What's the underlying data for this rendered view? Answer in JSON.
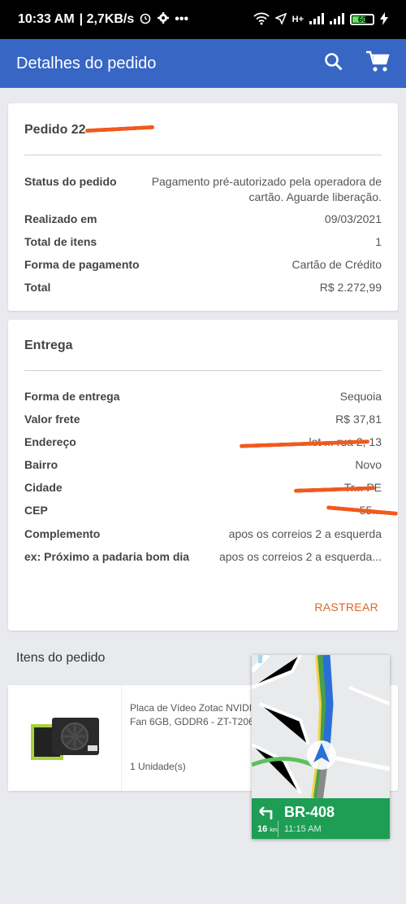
{
  "statusbar": {
    "time": "10:33 AM",
    "speed": "| 2,7KB/s",
    "battery": "60",
    "network": "H+"
  },
  "appbar": {
    "title": "Detalhes do pedido"
  },
  "pedido": {
    "title": "Pedido 22",
    "rows": [
      {
        "label": "Status do pedido",
        "value": "Pagamento pré-autorizado pela operadora de cartão. Aguarde liberação."
      },
      {
        "label": "Realizado em",
        "value": "09/03/2021"
      },
      {
        "label": "Total de itens",
        "value": "1"
      },
      {
        "label": "Forma de pagamento",
        "value": "Cartão de Crédito"
      },
      {
        "label": "Total",
        "value": "R$ 2.272,99"
      }
    ]
  },
  "entrega": {
    "title": "Entrega",
    "rows": [
      {
        "label": "Forma de entrega",
        "value": "Sequoia"
      },
      {
        "label": "Valor frete",
        "value": "R$ 37,81"
      },
      {
        "label": "Endereço",
        "value": "lot ... rua 2, 13"
      },
      {
        "label": "Bairro",
        "value": "Novo"
      },
      {
        "label": "Cidade",
        "value": "Tr... PE"
      },
      {
        "label": "CEP",
        "value": "55..."
      },
      {
        "label": "Complemento",
        "value": "apos os correios 2 a esquerda"
      },
      {
        "label": "ex: Próximo a padaria bom dia",
        "value": "apos os correios 2 a esquerda..."
      }
    ],
    "track_button": "RASTREAR"
  },
  "itens": {
    "section_title": "Itens do pedido",
    "item": {
      "name": "Placa de Vídeo Zotac NVIDI... Fan 6GB, GDDR6 - ZT-T2060...",
      "quantity": "1 Unidade(s)",
      "image_icon": "graphics-card-image"
    }
  },
  "navigation_overlay": {
    "road": "BR-408",
    "distance": "16",
    "distance_unit": "km",
    "eta": "11:15 AM"
  },
  "colors": {
    "appbar": "#3766c4",
    "accent": "#e0672a",
    "nav_green": "#1e9e55",
    "scribble": "#f05a1e"
  }
}
